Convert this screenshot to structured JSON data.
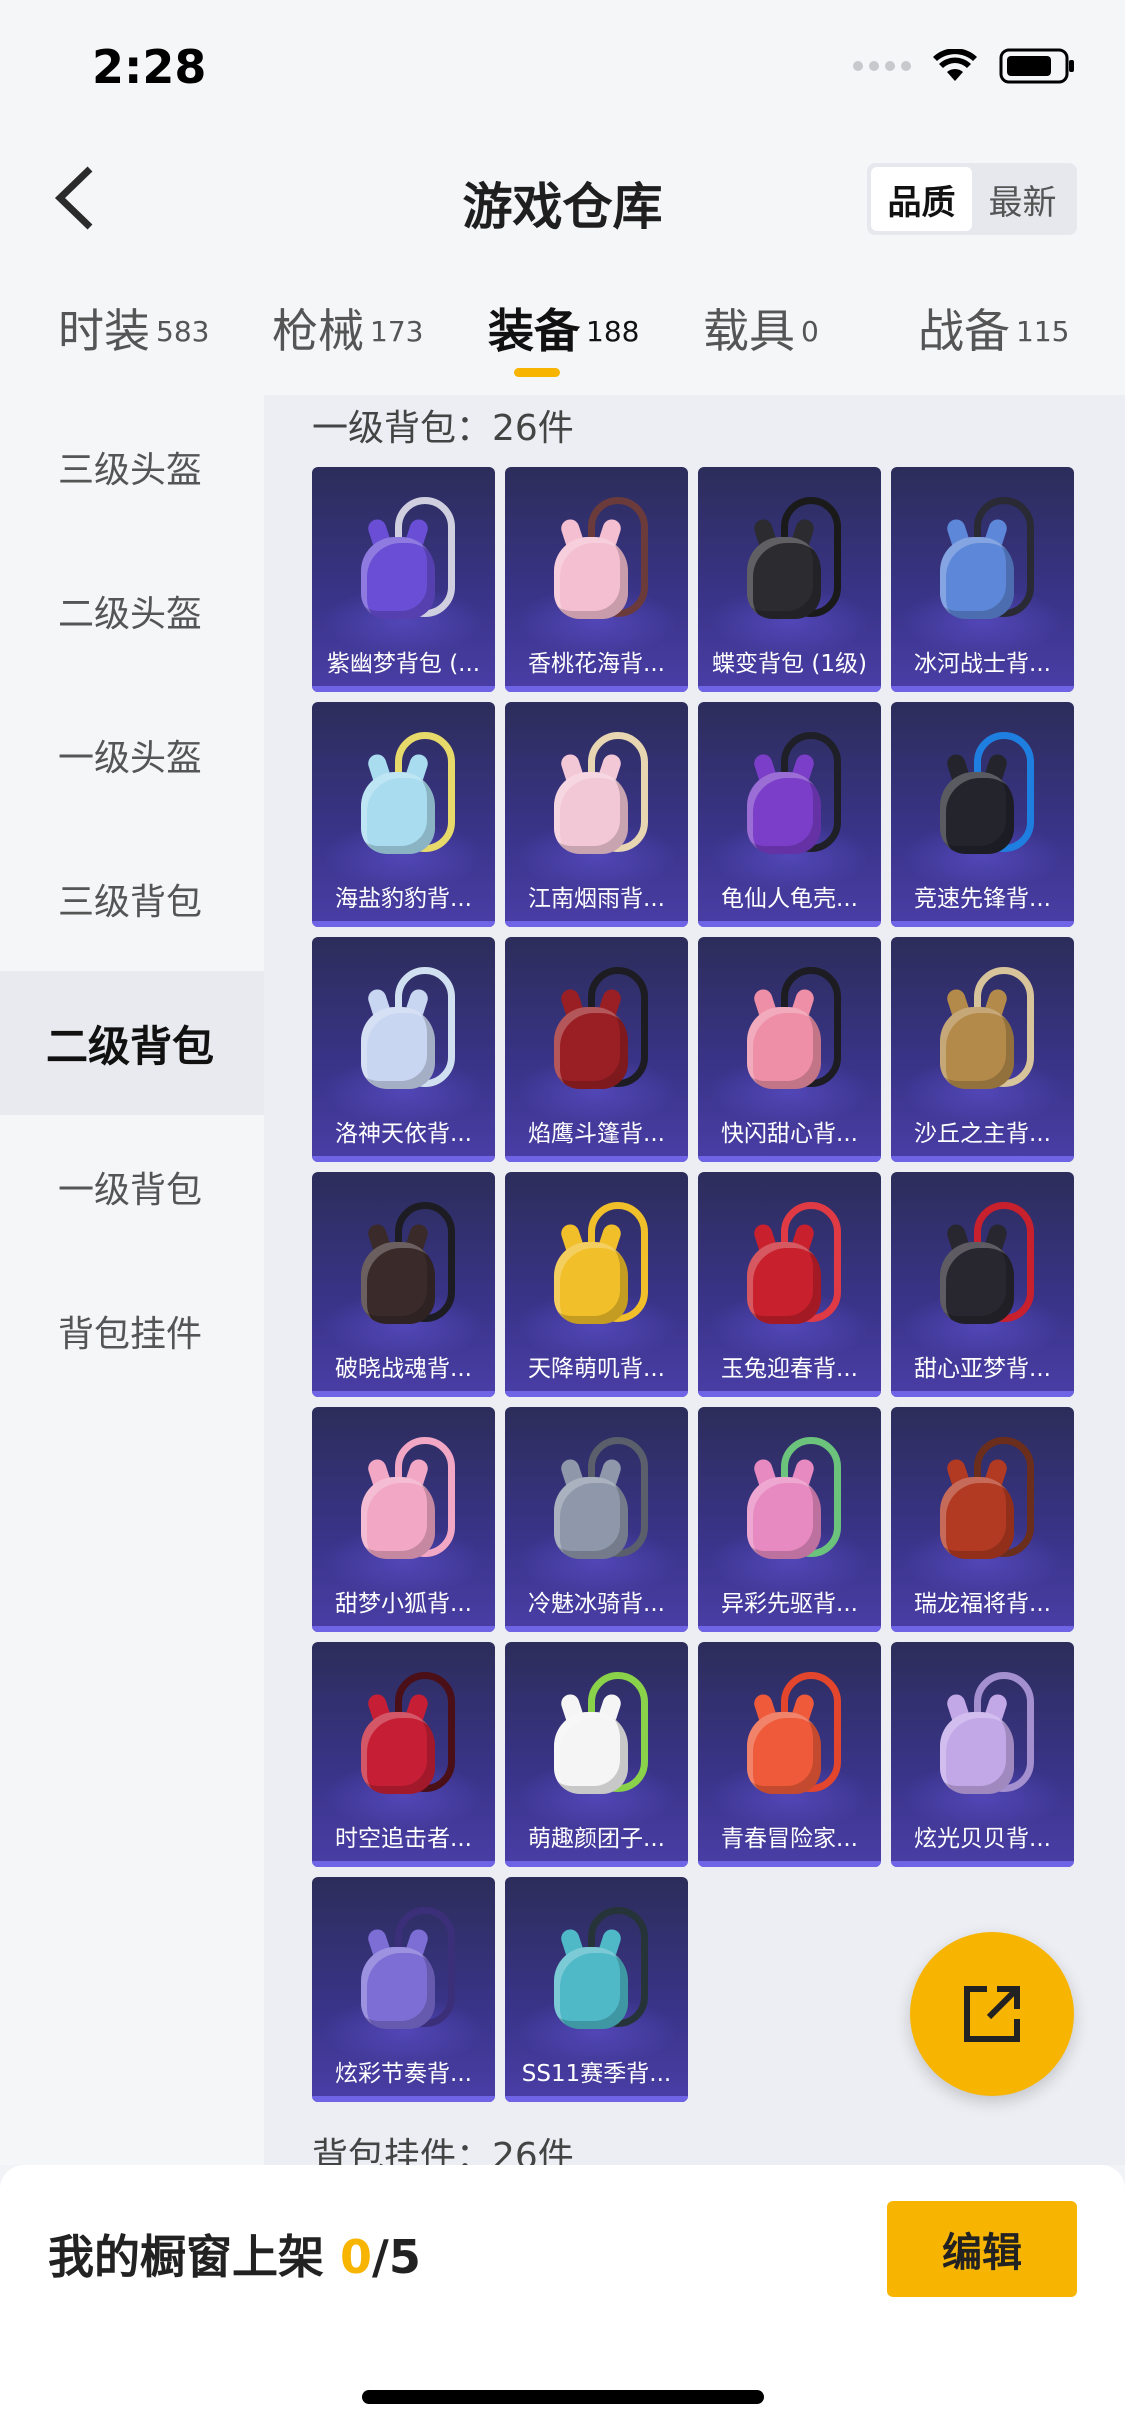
{
  "status": {
    "time": "2:28"
  },
  "header": {
    "title": "游戏仓库",
    "sort": [
      {
        "label": "品质",
        "active": true
      },
      {
        "label": "最新",
        "active": false
      }
    ]
  },
  "tabs": [
    {
      "label": "时装",
      "count": "583"
    },
    {
      "label": "枪械",
      "count": "173"
    },
    {
      "label": "装备",
      "count": "188",
      "active": true
    },
    {
      "label": "载具",
      "count": "0"
    },
    {
      "label": "战备",
      "count": "115"
    }
  ],
  "sidebar": [
    {
      "label": "三级头盔"
    },
    {
      "label": "二级头盔"
    },
    {
      "label": "一级头盔"
    },
    {
      "label": "三级背包"
    },
    {
      "label": "二级背包",
      "active": true
    },
    {
      "label": "一级背包"
    },
    {
      "label": "背包挂件"
    }
  ],
  "section": {
    "title": "一级背包：26件",
    "next_title": "背包挂件：26件"
  },
  "items": [
    {
      "name": "紫幽梦背包 (...",
      "color": "#6a4fd6",
      "strap": "#cfcfe0"
    },
    {
      "name": "香桃花海背...",
      "color": "#f4bfd0",
      "strap": "#6b3b3b"
    },
    {
      "name": "蝶变背包 (1级)",
      "color": "#2b2b30",
      "strap": "#1a1a1a"
    },
    {
      "name": "冰河战士背...",
      "color": "#5d87d8",
      "strap": "#2a2a35"
    },
    {
      "name": "海盐豹豹背...",
      "color": "#a9dcef",
      "strap": "#e7d96a"
    },
    {
      "name": "江南烟雨背...",
      "color": "#f3c8d6",
      "strap": "#e8d6b2"
    },
    {
      "name": "龟仙人龟壳...",
      "color": "#7a3ec8",
      "strap": "#1f1f28"
    },
    {
      "name": "竞速先锋背...",
      "color": "#23242c",
      "strap": "#1f7fe0"
    },
    {
      "name": "洛神天依背...",
      "color": "#c9d6f2",
      "strap": "#d0e0f0"
    },
    {
      "name": "焰鹰斗篷背...",
      "color": "#9a1f24",
      "strap": "#1c1c22"
    },
    {
      "name": "快闪甜心背...",
      "color": "#ee8fa7",
      "strap": "#1c1c22"
    },
    {
      "name": "沙丘之主背...",
      "color": "#b38a4a",
      "strap": "#d8c49b"
    },
    {
      "name": "破晓战魂背...",
      "color": "#3a2a2a",
      "strap": "#1c1c22"
    },
    {
      "name": "天降萌叽背...",
      "color": "#f1bf2a",
      "strap": "#f1bf2a"
    },
    {
      "name": "玉兔迎春背...",
      "color": "#c8202d",
      "strap": "#e03a44"
    },
    {
      "name": "甜心亚梦背...",
      "color": "#28262e",
      "strap": "#c8202d"
    },
    {
      "name": "甜梦小狐背...",
      "color": "#f2a7c5",
      "strap": "#f2a7c5"
    },
    {
      "name": "冷魅冰骑背...",
      "color": "#8e98aa",
      "strap": "#5a5f6b"
    },
    {
      "name": "异彩先驱背...",
      "color": "#e78ac1",
      "strap": "#6cc37c"
    },
    {
      "name": "瑞龙福将背...",
      "color": "#b33a22",
      "strap": "#6b2d1c"
    },
    {
      "name": "时空追击者...",
      "color": "#c61f35",
      "strap": "#4a0f17"
    },
    {
      "name": "萌趣颜团子...",
      "color": "#f5f5f5",
      "strap": "#8bd24b"
    },
    {
      "name": "青春冒险家...",
      "color": "#ee5a3a",
      "strap": "#e3462c"
    },
    {
      "name": "炫光贝贝背...",
      "color": "#c3a8e8",
      "strap": "#a48fcf"
    },
    {
      "name": "炫彩节奏背...",
      "color": "#7d6ed6",
      "strap": "#3c2f7a"
    },
    {
      "name": "SS11赛季背...",
      "color": "#4fb9c8",
      "strap": "#26343a"
    }
  ],
  "bottom": {
    "showcase_label": "我的橱窗上架",
    "count": "0",
    "total": "/5",
    "edit_label": "编辑"
  }
}
